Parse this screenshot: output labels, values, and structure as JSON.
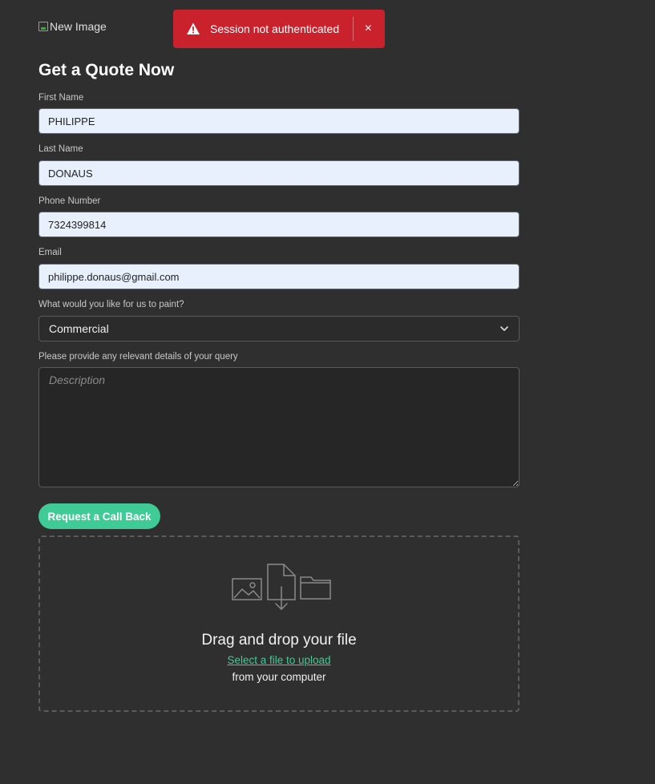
{
  "header": {
    "logo_alt": "New Image"
  },
  "toast": {
    "message": "Session not authenticated",
    "close_label": "×",
    "color": "#c9222c"
  },
  "form": {
    "title": "Get a Quote Now",
    "first_name": {
      "label": "First Name",
      "value": "PHILIPPE"
    },
    "last_name": {
      "label": "Last Name",
      "value": "DONAUS"
    },
    "phone": {
      "label": "Phone Number",
      "value": "7324399814"
    },
    "email": {
      "label": "Email",
      "value": "philippe.donaus@gmail.com"
    },
    "paint_type": {
      "label": "What would you like for us to paint?",
      "selected": "Commercial"
    },
    "details": {
      "label": "Please provide any relevant details of your query",
      "placeholder": "Description"
    },
    "submit_label": "Request a Call Back"
  },
  "upload": {
    "title": "Drag and drop your file",
    "link": "Select a file to upload",
    "subtext": "from your computer"
  },
  "colors": {
    "background": "#2f2f2f",
    "accent": "#3fcb95",
    "autofill": "#e8f0fe"
  }
}
